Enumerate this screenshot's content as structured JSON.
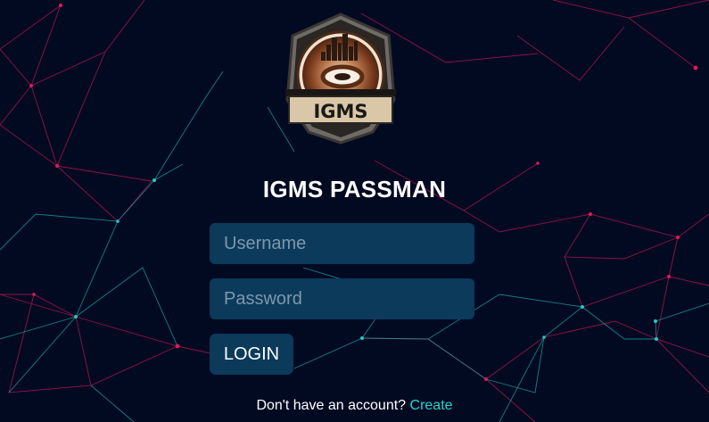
{
  "logo": {
    "text": "IGMS"
  },
  "app": {
    "title": "IGMS PASSMAN"
  },
  "form": {
    "username_placeholder": "Username",
    "password_placeholder": "Password",
    "login_label": "LOGIN"
  },
  "signup": {
    "prompt": "Don't have an account? ",
    "link_label": "Create"
  },
  "colors": {
    "background": "#020a22",
    "field": "#0b3a5a",
    "accent": "#22d7d1",
    "network_pink": "#e0185a",
    "network_cyan": "#1fc9c0"
  }
}
